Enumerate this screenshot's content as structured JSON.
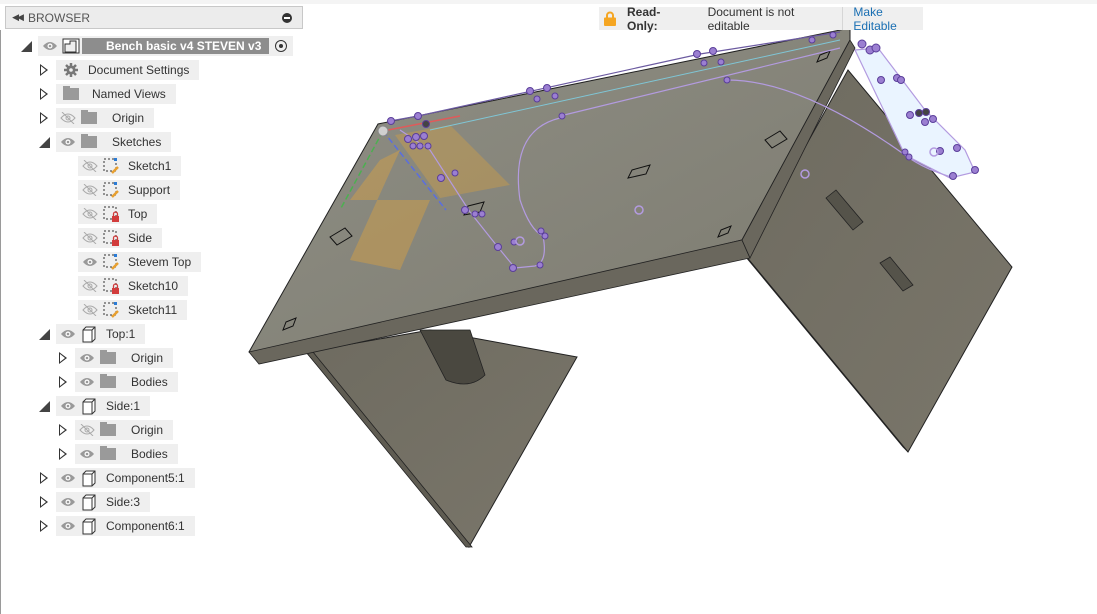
{
  "browser": {
    "title": "BROWSER",
    "collapse_icon": "double-chevron-left-icon",
    "minimize_icon": "minus-circle-icon",
    "root": {
      "label": "Bench basic v4 STEVEN v3",
      "icon": "assembly-icon",
      "active_icon": "radio-active-icon"
    },
    "items": [
      {
        "label": "Document Settings",
        "icon": "gear-icon"
      },
      {
        "label": "Named Views",
        "icon": "folder-icon"
      },
      {
        "label": "Origin",
        "icon": "folder-icon",
        "visible": false
      },
      {
        "label": "Sketches",
        "icon": "folder-icon",
        "visible": true,
        "expanded": true
      },
      {
        "label": "Sketch1",
        "icon": "sketch-icon",
        "visible": false
      },
      {
        "label": "Support",
        "icon": "sketch-icon",
        "visible": false
      },
      {
        "label": "Top",
        "icon": "sketch-locked-icon",
        "visible": false
      },
      {
        "label": "Side",
        "icon": "sketch-locked-icon",
        "visible": false
      },
      {
        "label": "Stevem Top",
        "icon": "sketch-icon",
        "visible": true
      },
      {
        "label": "Sketch10",
        "icon": "sketch-locked-icon",
        "visible": false
      },
      {
        "label": "Sketch11",
        "icon": "sketch-icon",
        "visible": false
      },
      {
        "label": "Top:1",
        "icon": "component-icon",
        "visible": true,
        "expanded": true
      },
      {
        "label": "Origin",
        "icon": "folder-icon",
        "visible": true
      },
      {
        "label": "Bodies",
        "icon": "folder-icon",
        "visible": true
      },
      {
        "label": "Side:1",
        "icon": "component-icon",
        "visible": true,
        "expanded": true
      },
      {
        "label": "Origin",
        "icon": "folder-icon",
        "visible": false
      },
      {
        "label": "Bodies",
        "icon": "folder-icon",
        "visible": true
      },
      {
        "label": "Component5:1",
        "icon": "component-icon",
        "visible": true
      },
      {
        "label": "Side:3",
        "icon": "component-icon",
        "visible": true
      },
      {
        "label": "Component6:1",
        "icon": "component-icon",
        "visible": true
      }
    ]
  },
  "readonly_bar": {
    "icon": "lock-icon",
    "title": "Read-Only:",
    "message": "Document is not editable",
    "action": "Make Editable",
    "accent": "#f5a623",
    "link_color": "#1a6fb3"
  },
  "viewport": {
    "model_color": "#7a776b",
    "sketch_color": "#9b7fd1",
    "plane_color": "#f0a830"
  }
}
